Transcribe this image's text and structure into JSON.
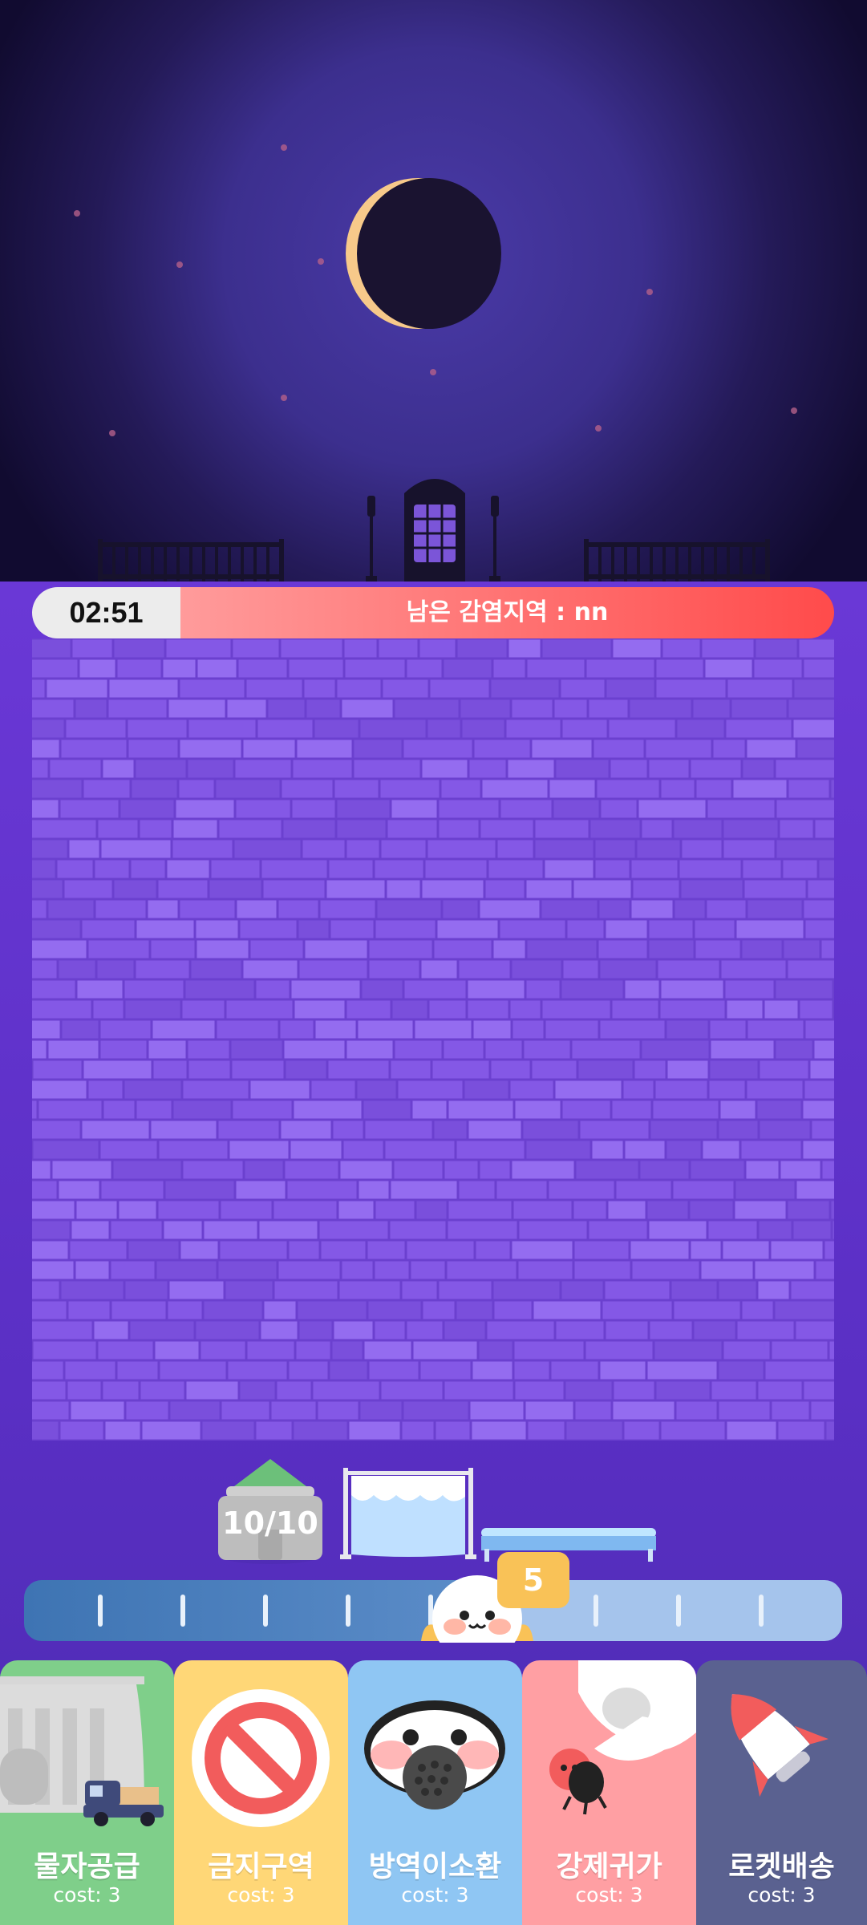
{
  "hud": {
    "timer": "02:51",
    "infection_label": "남은 감염지역 : nn",
    "supply_count": "10/10",
    "level_badge": "5"
  },
  "slider": {
    "tick_count": 9
  },
  "cards": [
    {
      "name": "물자공급",
      "cost": "cost: 3",
      "color": "#7fcf8a",
      "icon": "supply-truck-icon"
    },
    {
      "name": "금지구역",
      "cost": "cost: 3",
      "color": "#ffd777",
      "icon": "no-entry-icon"
    },
    {
      "name": "방역이소환",
      "cost": "cost: 3",
      "color": "#8fc6f3",
      "icon": "mask-character-icon"
    },
    {
      "name": "강제귀가",
      "cost": "cost: 3",
      "color": "#ff9fa3",
      "icon": "grab-hand-icon"
    },
    {
      "name": "로켓배송",
      "cost": "cost: 3",
      "color": "#5a6190",
      "icon": "rocket-icon"
    }
  ],
  "colors": {
    "board_brick": "#8458e6",
    "board_mortar": "#6b40cf",
    "timer_bg": "#ececec",
    "infection_gradient": [
      "#ff9b9b",
      "#ff4b4b"
    ],
    "slider_filled": "#3e74b3",
    "slider_empty": "#a5c4ec",
    "badge": "#f9c257"
  }
}
